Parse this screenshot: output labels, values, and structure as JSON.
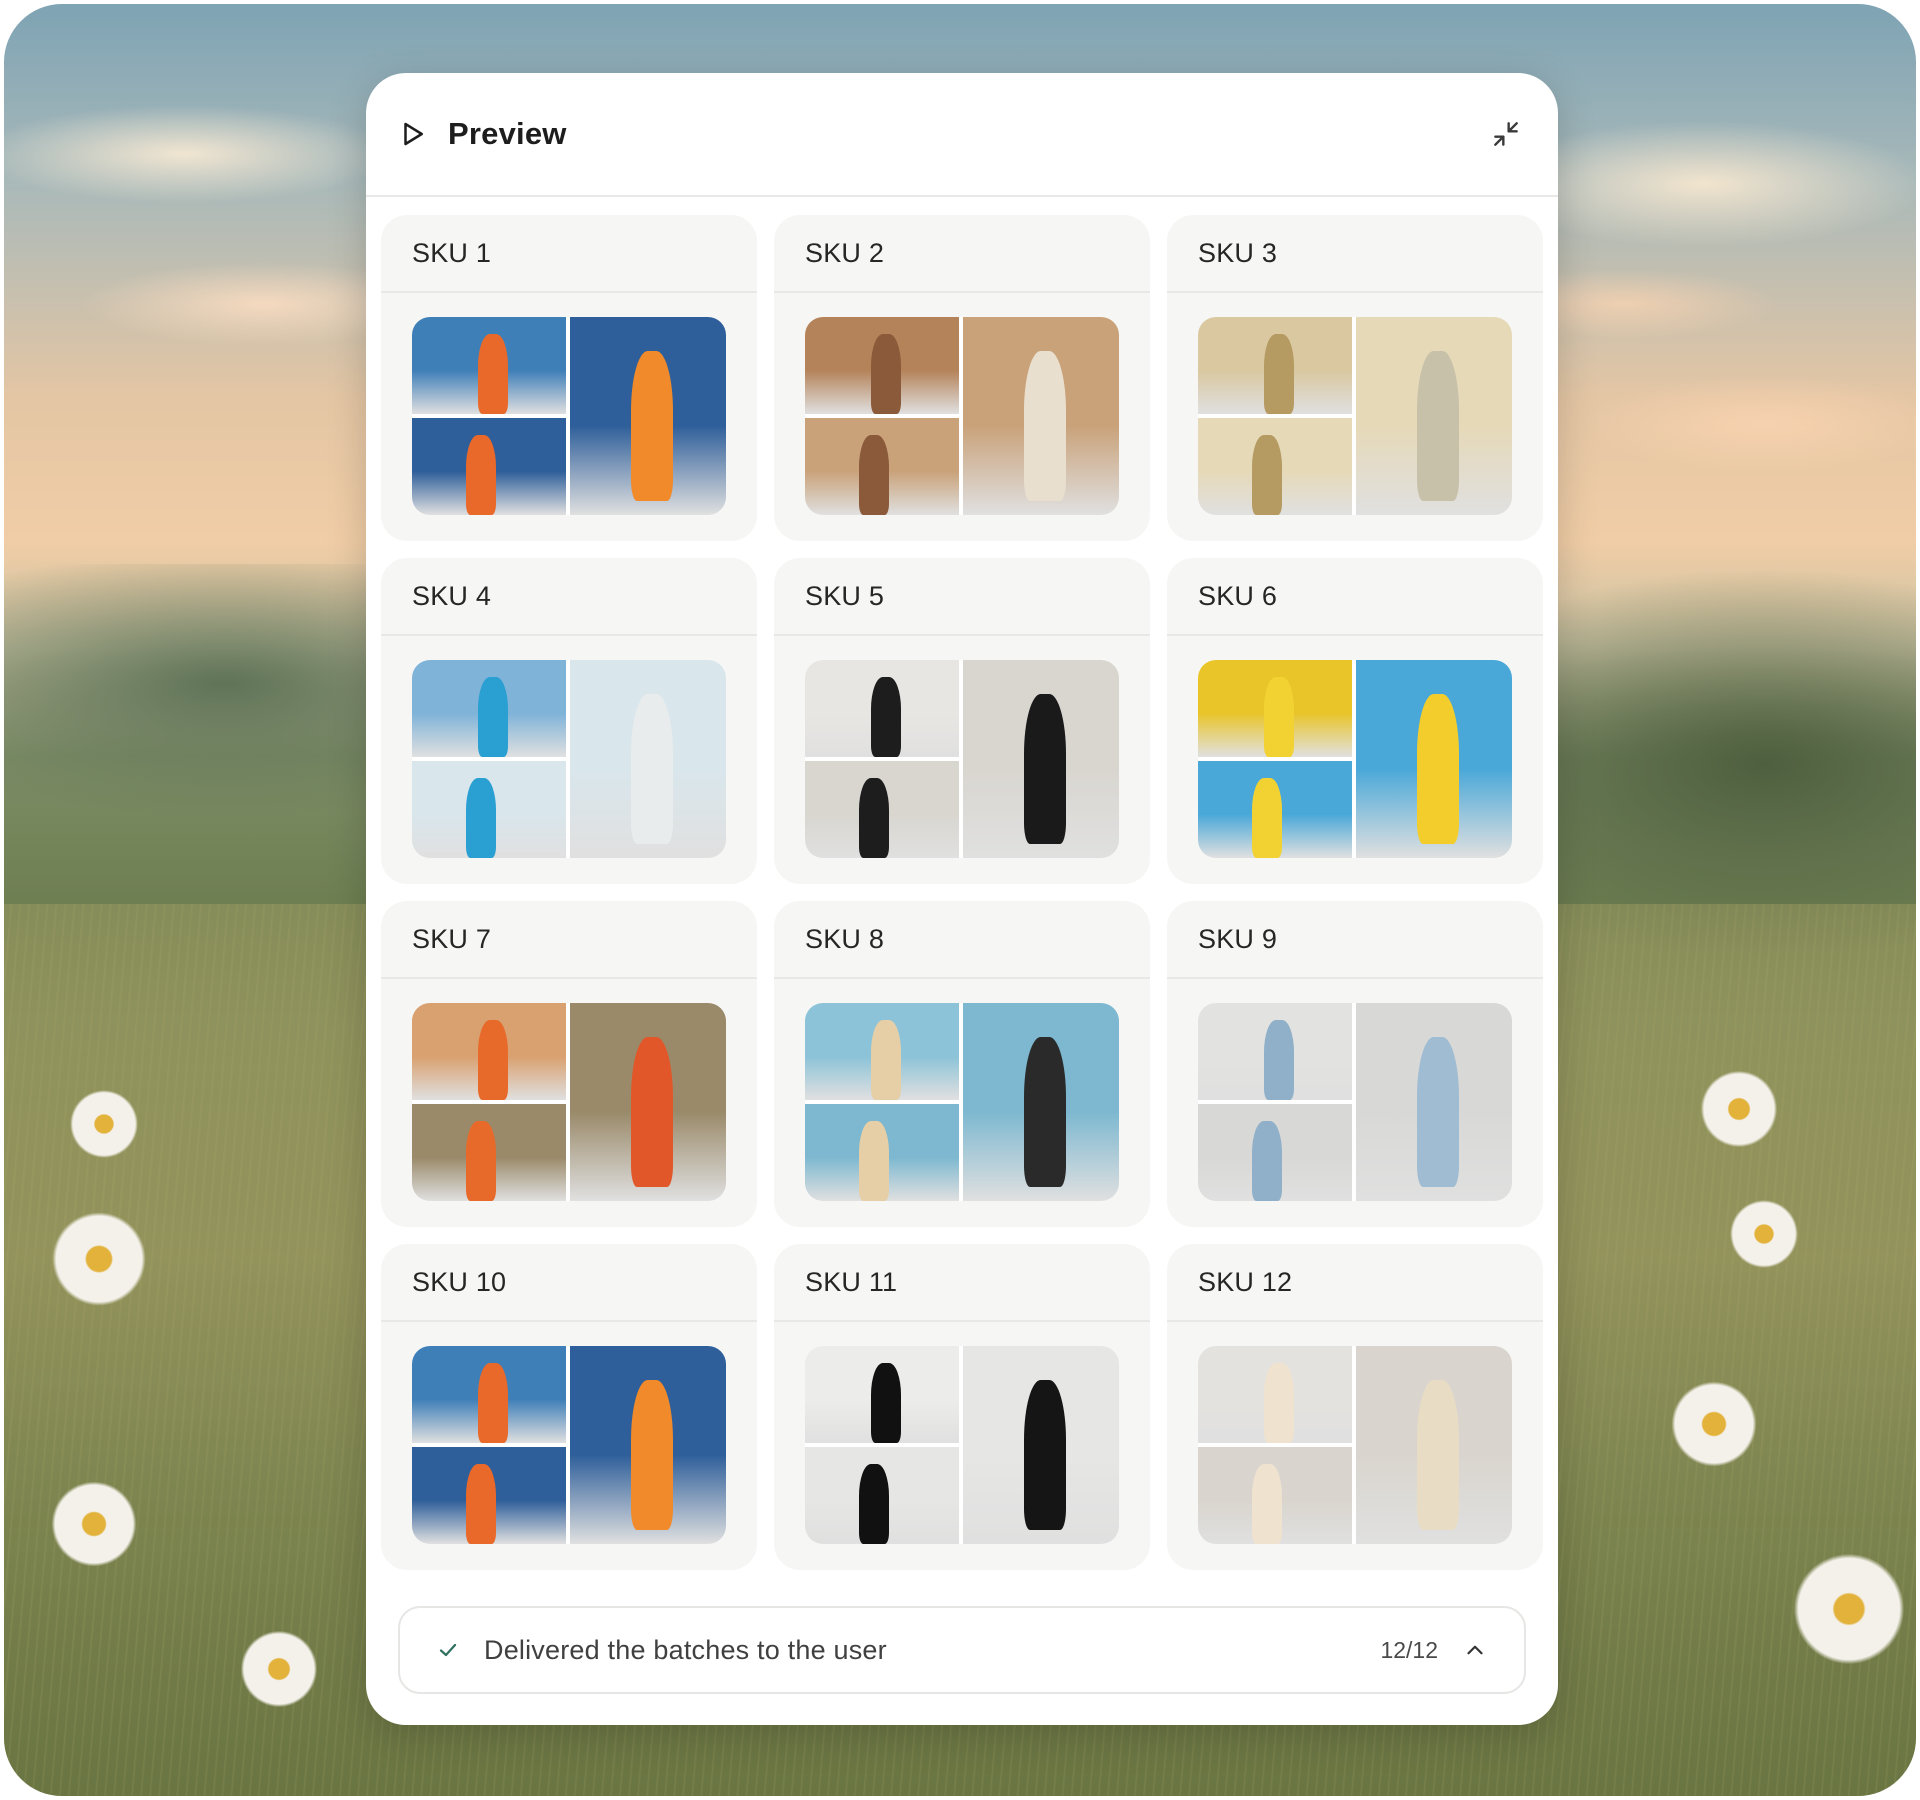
{
  "panel": {
    "title": "Preview",
    "icons": {
      "play": "play-icon",
      "collapse": "collapse-icon"
    }
  },
  "skus": [
    {
      "label": "SKU 1",
      "palette": [
        "#3f7fb8",
        "#e8692a",
        "#2f5f9a",
        "#f08a2a"
      ]
    },
    {
      "label": "SKU 2",
      "palette": [
        "#b5835a",
        "#8a5a3a",
        "#c9a27a",
        "#e9dfcf"
      ]
    },
    {
      "label": "SKU 3",
      "palette": [
        "#d9c8a0",
        "#b59a62",
        "#e6d9b8",
        "#c7c1aa"
      ]
    },
    {
      "label": "SKU 4",
      "palette": [
        "#7fb3d8",
        "#2a9fd2",
        "#d9e6ec",
        "#e9ecec"
      ]
    },
    {
      "label": "SKU 5",
      "palette": [
        "#e8e6e2",
        "#1d1d1d",
        "#d9d6d0",
        "#1a1a1a"
      ]
    },
    {
      "label": "SKU 6",
      "palette": [
        "#e9c52a",
        "#f2d233",
        "#4aa8d8",
        "#f2cd2c"
      ]
    },
    {
      "label": "SKU 7",
      "palette": [
        "#d9a070",
        "#e86a2a",
        "#9a8a6a",
        "#e2572a"
      ]
    },
    {
      "label": "SKU 8",
      "palette": [
        "#8cc3d8",
        "#e6cfa6",
        "#7db8d0",
        "#2a2a2a"
      ]
    },
    {
      "label": "SKU 9",
      "palette": [
        "#e2e2e0",
        "#8fb0c8",
        "#d8d8d6",
        "#9fbcd2"
      ]
    },
    {
      "label": "SKU 10",
      "palette": [
        "#3f7fb8",
        "#e8692a",
        "#2f5f9a",
        "#f08a2a"
      ]
    },
    {
      "label": "SKU 11",
      "palette": [
        "#ececea",
        "#111111",
        "#e6e6e4",
        "#151515"
      ]
    },
    {
      "label": "SKU 12",
      "palette": [
        "#e4e2de",
        "#efe3cf",
        "#d9d5ce",
        "#e9dcc4"
      ]
    }
  ],
  "status": {
    "text": "Delivered the batches to the user",
    "count": "12/12",
    "icons": {
      "check": "check-icon",
      "expand": "chevron-up-icon"
    },
    "accent": "#2f6f5e"
  }
}
